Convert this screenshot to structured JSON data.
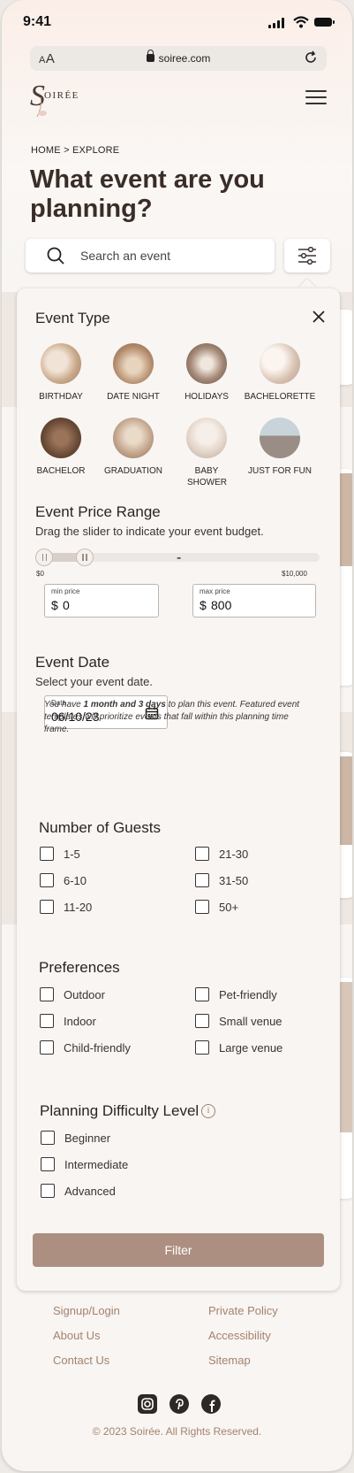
{
  "status_bar": {
    "time": "9:41"
  },
  "browser": {
    "text_size": "AA",
    "url": "soiree.com"
  },
  "brand": {
    "logo_text": "OIRÉE"
  },
  "breadcrumb": {
    "home": "HOME",
    "separator": " > ",
    "current": "EXPLORE"
  },
  "page_title": "What event are you planning?",
  "search": {
    "placeholder": "Search an event"
  },
  "filter_panel": {
    "event_type": {
      "title": "Event Type",
      "items": [
        {
          "label": "BIRTHDAY",
          "color": "#c9a889"
        },
        {
          "label": "DATE NIGHT",
          "color": "#b58e6e"
        },
        {
          "label": "HOLIDAYS",
          "color": "#a68a78"
        },
        {
          "label": "BACHELORETTE",
          "color": "#d9c3b3"
        },
        {
          "label": "BACHELOR",
          "color": "#6a4b37"
        },
        {
          "label": "GRADUATION",
          "color": "#c2a38b"
        },
        {
          "label": "BABY SHOWER",
          "color": "#e1d3c7"
        },
        {
          "label": "JUST FOR FUN",
          "color": "#9a8d86"
        }
      ]
    },
    "price": {
      "title": "Event Price Range",
      "subtitle": "Drag the slider to indicate your event budget.",
      "min_tick": "$0",
      "max_tick": "$10,000",
      "range_fraction": [
        0.0,
        0.08
      ],
      "min_label": "min price",
      "max_label": "max price",
      "currency": "$",
      "min_value": "0",
      "max_value": "800",
      "separator": "-"
    },
    "date": {
      "title": "Event Date",
      "subtitle": "Select your event date.",
      "field_label": "Date",
      "value": "06/10/23",
      "note_prefix": "You have ",
      "note_bold": "1 month and 3 days",
      "note_suffix": " to plan this event. Featured event templates will prioritize events that fall within this planning time frame."
    },
    "guests": {
      "title": "Number of Guests",
      "options": [
        "1-5",
        "21-30",
        "6-10",
        "31-50",
        "11-20",
        "50+"
      ]
    },
    "preferences": {
      "title": "Preferences",
      "options": [
        "Outdoor",
        "Pet-friendly",
        "Indoor",
        "Small venue",
        "Child-friendly",
        "Large venue"
      ]
    },
    "difficulty": {
      "title": "Planning Difficulty Level",
      "info": "i",
      "options": [
        "Beginner",
        "Intermediate",
        "Advanced"
      ]
    },
    "submit_label": "Filter"
  },
  "footer": {
    "links": [
      "Signup/Login",
      "Private Policy",
      "About Us",
      "Accessibility",
      "Contact Us",
      "Sitemap"
    ],
    "copyright": "© 2023 Soirée. All Rights Reserved."
  },
  "colors": {
    "accent": "#ac8f80",
    "footer_text": "#a4836e",
    "title": "#3a2d27"
  }
}
